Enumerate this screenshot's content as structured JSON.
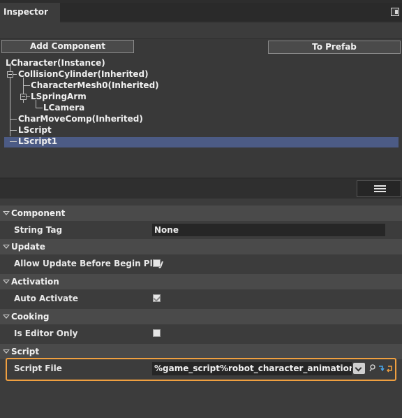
{
  "panel": {
    "title": "Inspector",
    "dock_icon": "dock-icon"
  },
  "buttons": {
    "add_component": "Add Component",
    "to_prefab": "To Prefab"
  },
  "tree": [
    {
      "label": "LCharacter(Instance)",
      "selected": false
    },
    {
      "label": "CollisionCylinder(Inherited)",
      "selected": false
    },
    {
      "label": "CharacterMesh0(Inherited)",
      "selected": false
    },
    {
      "label": "LSpringArm",
      "selected": false
    },
    {
      "label": "LCamera",
      "selected": false
    },
    {
      "label": "CharMoveComp(Inherited)",
      "selected": false
    },
    {
      "label": "LScript",
      "selected": false
    },
    {
      "label": "LScript1",
      "selected": true
    }
  ],
  "toolbar": {
    "menu_icon": "hamburger-menu-icon"
  },
  "sections": {
    "component": {
      "title": "Component",
      "string_tag_label": "String Tag",
      "string_tag_value": "None"
    },
    "update": {
      "title": "Update",
      "allow_update_label": "Allow Update Before Begin Play",
      "allow_update_checked": false
    },
    "activation": {
      "title": "Activation",
      "auto_activate_label": "Auto Activate",
      "auto_activate_checked": true
    },
    "cooking": {
      "title": "Cooking",
      "editor_only_label": "Is Editor Only",
      "editor_only_checked": false
    },
    "script": {
      "title": "Script",
      "script_file_label": "Script File",
      "script_file_value": "%game_script%robot_character_animation.lua"
    }
  },
  "colors": {
    "selection": "#4c5b85",
    "highlight_border": "#f0a040",
    "accent_blue": "#4aa6e8"
  }
}
